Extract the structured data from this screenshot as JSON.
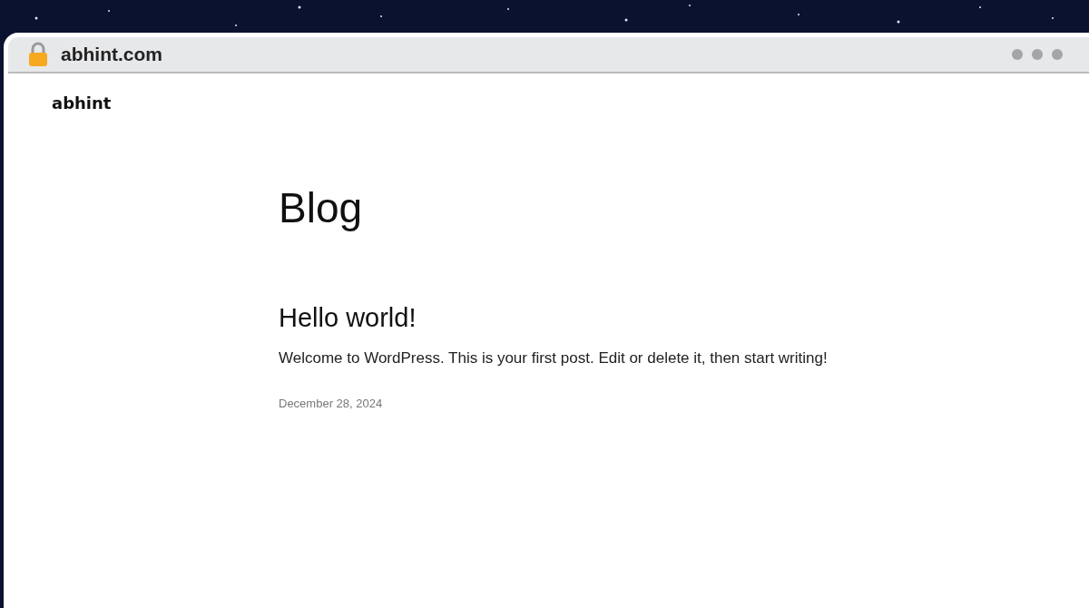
{
  "browser": {
    "address": "abhint.com"
  },
  "site": {
    "title": "abhint"
  },
  "page": {
    "heading": "Blog"
  },
  "posts": [
    {
      "title": "Hello world!",
      "excerpt": "Welcome to WordPress. This is your first post. Edit or delete it, then start writing!",
      "date": "December 28, 2024"
    }
  ]
}
